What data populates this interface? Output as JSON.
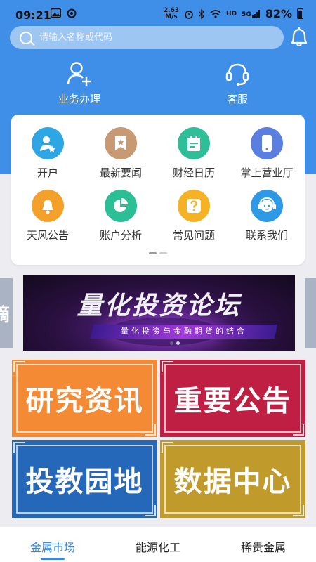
{
  "status_bar": {
    "time": "09:21",
    "left_icons": [
      "image-icon",
      "sync-icon"
    ],
    "speed_value": "2.63",
    "speed_unit": "M/s",
    "right_icons": [
      "alarm-icon",
      "bluetooth-icon",
      "wifi-icon",
      "hd-icon",
      "5g-signal-icon"
    ],
    "hd_label": "HD",
    "network_label": "5G",
    "battery": "82%"
  },
  "search": {
    "placeholder": "请输入名称或代码"
  },
  "top_actions": [
    {
      "label": "业务办理",
      "icon": "add-user-icon"
    },
    {
      "label": "客服",
      "icon": "headset-icon"
    }
  ],
  "grid": {
    "items": [
      {
        "label": "开户",
        "icon": "account-open-icon",
        "color": "#2fa6e4"
      },
      {
        "label": "最新要闻",
        "icon": "bookmark-news-icon",
        "color": "#c79a73"
      },
      {
        "label": "财经日历",
        "icon": "calendar-icon",
        "color": "#2ebf98"
      },
      {
        "label": "掌上营业厅",
        "icon": "mobile-phone-icon",
        "color": "#5b7fe0"
      },
      {
        "label": "天风公告",
        "icon": "bell-icon",
        "color": "#f3a12b"
      },
      {
        "label": "账户分析",
        "icon": "pie-chart-icon",
        "color": "#2bbf96"
      },
      {
        "label": "常见问题",
        "icon": "question-icon",
        "color": "#f5b224"
      },
      {
        "label": "联系我们",
        "icon": "contact-icon",
        "color": "#2e9ae6"
      }
    ],
    "page_count": 2,
    "active_page": 1
  },
  "banner": {
    "title": "量化投资论坛",
    "subtitle": "量化投资与金融期货的结合",
    "side_text": "摘",
    "slide_count": 2,
    "active_slide": 2
  },
  "tiles": {
    "research": {
      "label": "研究资讯",
      "color": "#f58a35"
    },
    "notice": {
      "label": "重要公告",
      "color": "#c01f44"
    },
    "education": {
      "label": "投教园地",
      "color": "#2567b8"
    },
    "data_center": {
      "label": "数据中心",
      "color": "#c09a2a"
    }
  },
  "bottom_tabs": [
    {
      "label": "金属市场",
      "active": true
    },
    {
      "label": "能源化工",
      "active": false
    },
    {
      "label": "稀贵金属",
      "active": false
    }
  ],
  "colors": {
    "header_blue": "#3f8fe9",
    "accent": "#3b86e2"
  }
}
